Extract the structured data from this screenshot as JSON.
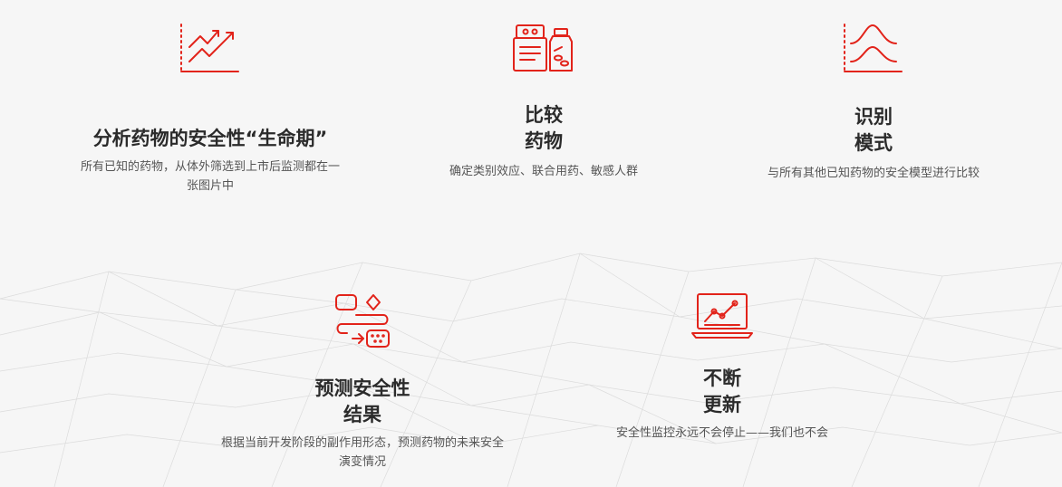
{
  "colors": {
    "accent": "#e2231a",
    "title": "#2b2b2b",
    "text": "#555555",
    "background": "#f6f6f6"
  },
  "features": [
    {
      "icon": "trend-chart-icon",
      "title": "分析药物的安全性“生命期”",
      "desc_lines": [
        "所有已知的药物，从体外筛选到上市后监测都在一",
        "张图片中"
      ]
    },
    {
      "icon": "drug-comparison-icon",
      "title_lines": [
        "比较",
        "药物"
      ],
      "desc_lines": [
        "确定类别效应、联合用药、敏感人群"
      ]
    },
    {
      "icon": "waveform-pattern-icon",
      "title_lines": [
        "识别",
        "模式"
      ],
      "desc_lines": [
        "与所有其他已知药物的安全模型进行比较"
      ]
    },
    {
      "icon": "flow-prediction-icon",
      "title_lines": [
        "预测安全性",
        "结果"
      ],
      "desc_lines": [
        "根据当前开发阶段的副作用形态，预测药物的未来安全",
        "演变情况"
      ]
    },
    {
      "icon": "laptop-monitoring-icon",
      "title_lines": [
        "不断",
        "更新"
      ],
      "desc_lines": [
        "安全性监控永远不会停止——我们也不会"
      ]
    }
  ]
}
